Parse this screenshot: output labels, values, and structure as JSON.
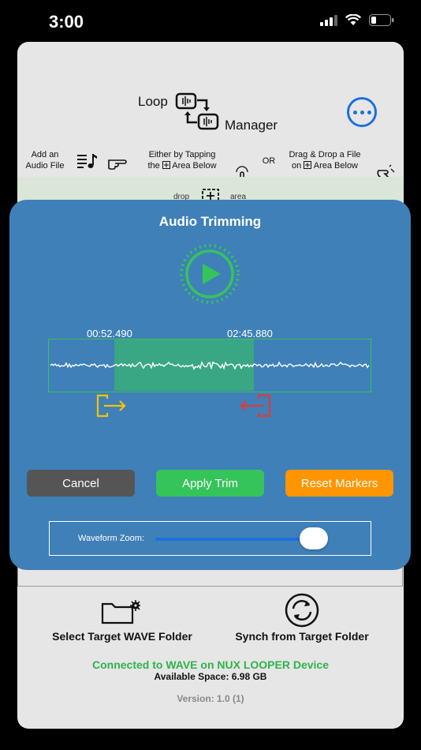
{
  "status": {
    "time": "3:00"
  },
  "logo": {
    "word1": "Loop",
    "word2": "Manager"
  },
  "instructions": {
    "add_line1": "Add an",
    "add_line2": "Audio File",
    "tap_line1": "Either by Tapping",
    "tap_line2_a": "the",
    "tap_line2_b": "Area Below",
    "or_label": "OR",
    "drag_line1": "Drag & Drop a File",
    "drag_line2_a": "on",
    "drag_line2_b": "Area Below"
  },
  "drop_area": {
    "left_label": "drop",
    "right_label": "area"
  },
  "trim_panel": {
    "title": "Audio Trimming",
    "start_time": "00:52.490",
    "end_time": "02:45.880",
    "cancel_label": "Cancel",
    "apply_label": "Apply Trim",
    "reset_label": "Reset Markers",
    "zoom_label": "Waveform Zoom:",
    "zoom_level": 0.94
  },
  "bottom": {
    "select_folder_label": "Select Target WAVE Folder",
    "synch_label": "Synch from Target Folder",
    "connected_text": "Connected to WAVE on NUX LOOPER Device",
    "space_text": "Available Space: 6.98 GB",
    "version_text": "Version: 1.0 (1)"
  },
  "colors": {
    "accent_blue": "#1b6fe0",
    "panel_blue": "#3f80b8",
    "green": "#35c45a",
    "orange": "#ff9500",
    "cancel_gray": "#555555",
    "start_marker_yellow": "#f5c400",
    "end_marker_red": "#e53935"
  }
}
